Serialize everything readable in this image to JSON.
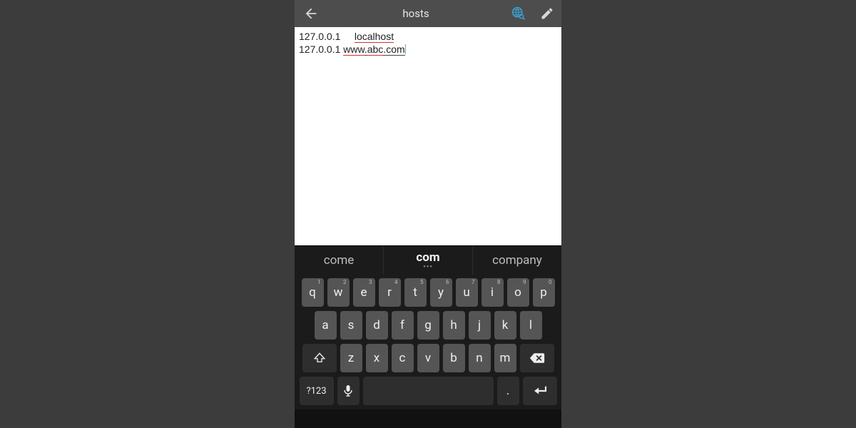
{
  "topbar": {
    "title": "hosts"
  },
  "editor": {
    "line1_ip": "127.0.0.1",
    "line1_gap": "     ",
    "line1_host": "localhost",
    "line2_ip": "127.0.0.1 ",
    "line2_host1": "www",
    "line2_dot1": ".",
    "line2_host2": "abc",
    "line2_dot2": ".",
    "line2_host3": "com"
  },
  "sugg": {
    "a": "come",
    "b": "com",
    "c": "company"
  },
  "keys": {
    "row1": [
      "q",
      "w",
      "e",
      "r",
      "t",
      "y",
      "u",
      "i",
      "o",
      "p"
    ],
    "row1hints": [
      "1",
      "2",
      "3",
      "4",
      "5",
      "6",
      "7",
      "8",
      "9",
      "0"
    ],
    "row2": [
      "a",
      "s",
      "d",
      "f",
      "g",
      "h",
      "j",
      "k",
      "l"
    ],
    "row3": [
      "z",
      "x",
      "c",
      "v",
      "b",
      "n",
      "m"
    ],
    "sym": "?123",
    "period": "."
  },
  "colors": {
    "accent": "#3aa3d6"
  }
}
